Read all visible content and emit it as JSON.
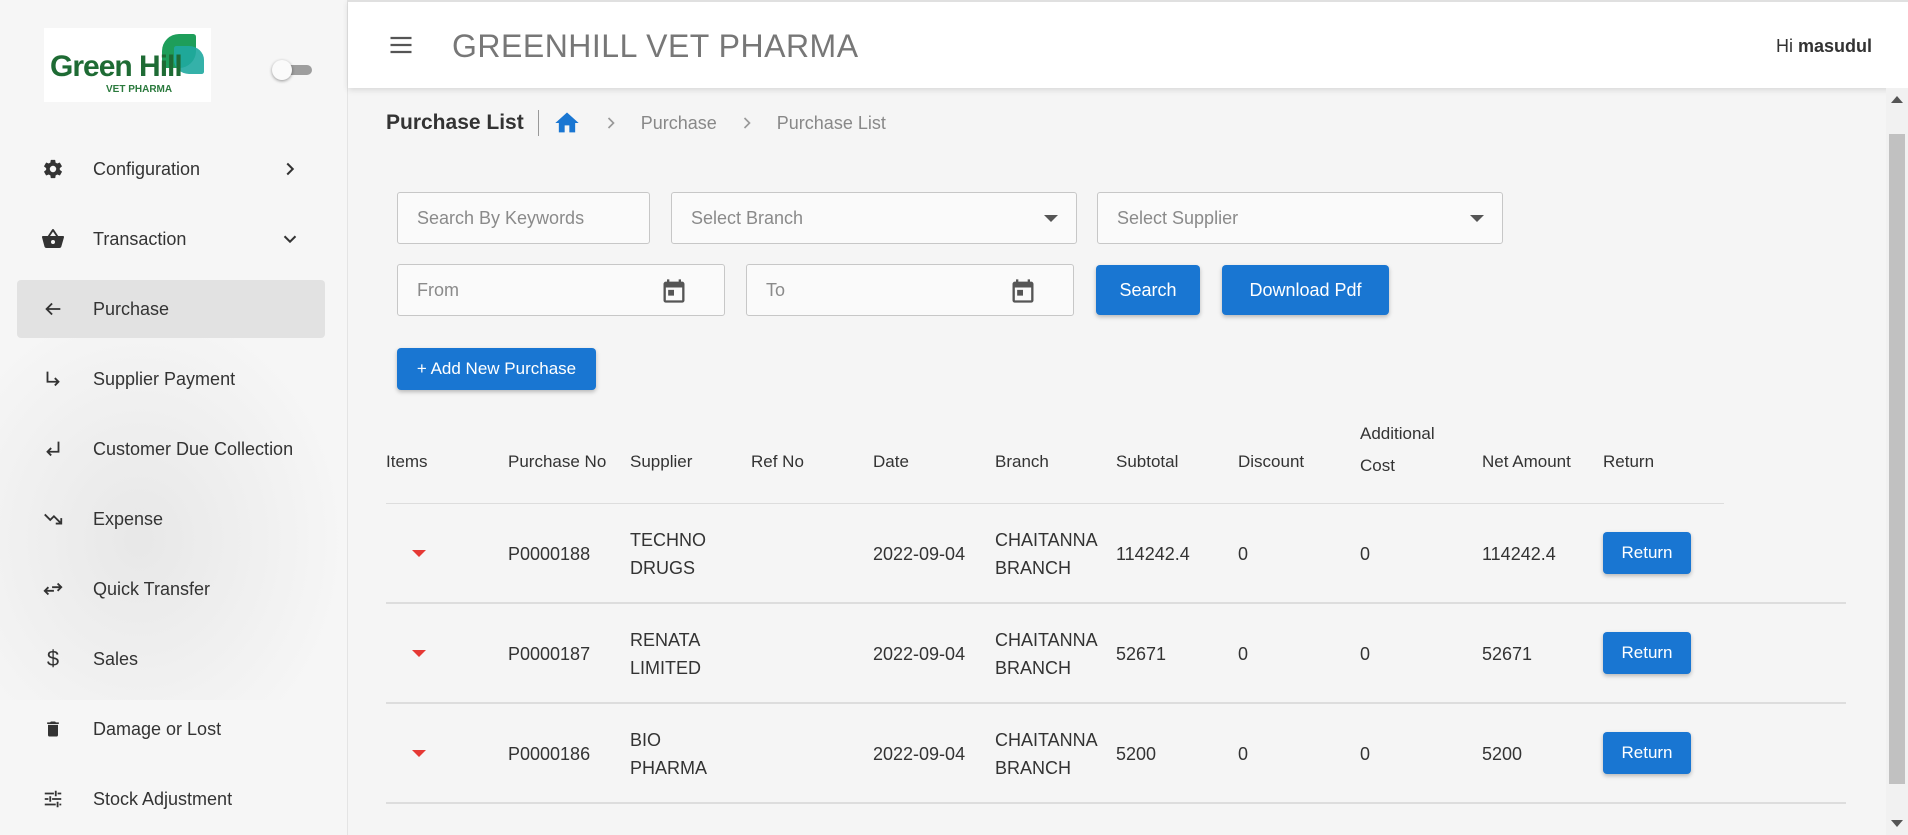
{
  "app": {
    "title": "GREENHILL VET PHARMA",
    "greeting_prefix": "Hi",
    "user": "masudul"
  },
  "logo": {
    "text": "Green Hill",
    "sub": "VET PHARMA"
  },
  "sidebar": {
    "items": [
      {
        "label": "Configuration",
        "icon": "gear-icon",
        "chevron": "right"
      },
      {
        "label": "Transaction",
        "icon": "basket-icon",
        "chevron": "down"
      },
      {
        "label": "Purchase",
        "icon": "arrow-left-icon",
        "active": true
      },
      {
        "label": "Supplier Payment",
        "icon": "subdirectory-arrow-right-icon"
      },
      {
        "label": "Customer Due Collection",
        "icon": "subdirectory-arrow-left-icon"
      },
      {
        "label": "Expense",
        "icon": "trending-down-icon"
      },
      {
        "label": "Quick Transfer",
        "icon": "transfer-icon"
      },
      {
        "label": "Sales",
        "icon": "dollar-icon"
      },
      {
        "label": "Damage or Lost",
        "icon": "trash-icon"
      },
      {
        "label": "Stock Adjustment",
        "icon": "tune-icon"
      }
    ]
  },
  "breadcrumb": {
    "title": "Purchase List",
    "items": [
      "Purchase",
      "Purchase List"
    ]
  },
  "filters": {
    "keyword_placeholder": "Search By Keywords",
    "branch_placeholder": "Select Branch",
    "supplier_placeholder": "Select Supplier",
    "from_placeholder": "From",
    "to_placeholder": "To",
    "search_label": "Search",
    "download_label": "Download Pdf",
    "add_label": "+ Add New Purchase"
  },
  "table": {
    "headers": {
      "items": "Items",
      "purchase_no": "Purchase No",
      "supplier": "Supplier",
      "ref_no": "Ref No",
      "date": "Date",
      "branch": "Branch",
      "subtotal": "Subtotal",
      "discount": "Discount",
      "additional_cost_1": "Additional",
      "additional_cost_2": "Cost",
      "net_amount": "Net Amount",
      "return": "Return"
    },
    "rows": [
      {
        "purchase_no": "P0000188",
        "supplier_1": "TECHNO",
        "supplier_2": "DRUGS",
        "ref_no": "",
        "date": "2022-09-04",
        "branch_1": "CHAITANNA",
        "branch_2": "BRANCH",
        "subtotal": "114242.4",
        "discount": "0",
        "additional_cost": "0",
        "net_amount": "114242.4",
        "return_label": "Return"
      },
      {
        "purchase_no": "P0000187",
        "supplier_1": "RENATA",
        "supplier_2": "LIMITED",
        "ref_no": "",
        "date": "2022-09-04",
        "branch_1": "CHAITANNA",
        "branch_2": "BRANCH",
        "subtotal": "52671",
        "discount": "0",
        "additional_cost": "0",
        "net_amount": "52671",
        "return_label": "Return"
      },
      {
        "purchase_no": "P0000186",
        "supplier_1": "BIO",
        "supplier_2": "PHARMA",
        "ref_no": "",
        "date": "2022-09-04",
        "branch_1": "CHAITANNA",
        "branch_2": "BRANCH",
        "subtotal": "5200",
        "discount": "0",
        "additional_cost": "0",
        "net_amount": "5200",
        "return_label": "Return"
      }
    ]
  },
  "colors": {
    "primary": "#1976d2",
    "expand_arrow": "#e53935",
    "logo_green": "#1e6b34"
  }
}
